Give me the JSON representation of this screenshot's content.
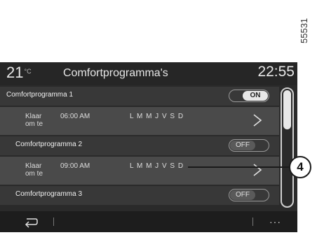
{
  "figure_ref": "55531",
  "header": {
    "temperature": "21",
    "temperature_unit": "°C",
    "title": "Comfortprogramma's",
    "clock": "22:55"
  },
  "programs": [
    {
      "name": "Comfortprogramma 1",
      "toggle": "ON",
      "ready_label": "Klaar om te",
      "time": "06:00 AM",
      "days": "L M M J V S D"
    },
    {
      "name": "Comfortprogramma 2",
      "toggle": "OFF",
      "ready_label": "Klaar om te",
      "time": "09:00 AM",
      "days": "L M M J V S D"
    },
    {
      "name": "Comfortprogramma 3",
      "toggle": "OFF"
    }
  ],
  "footer": {
    "more_label": "···"
  },
  "callout": {
    "number": "4"
  },
  "colors": {
    "screen_bg": "#2a2a2a",
    "program_row_bg": "#383838",
    "detail_row_bg": "#4a4a4a",
    "text": "#e6e6e6"
  }
}
